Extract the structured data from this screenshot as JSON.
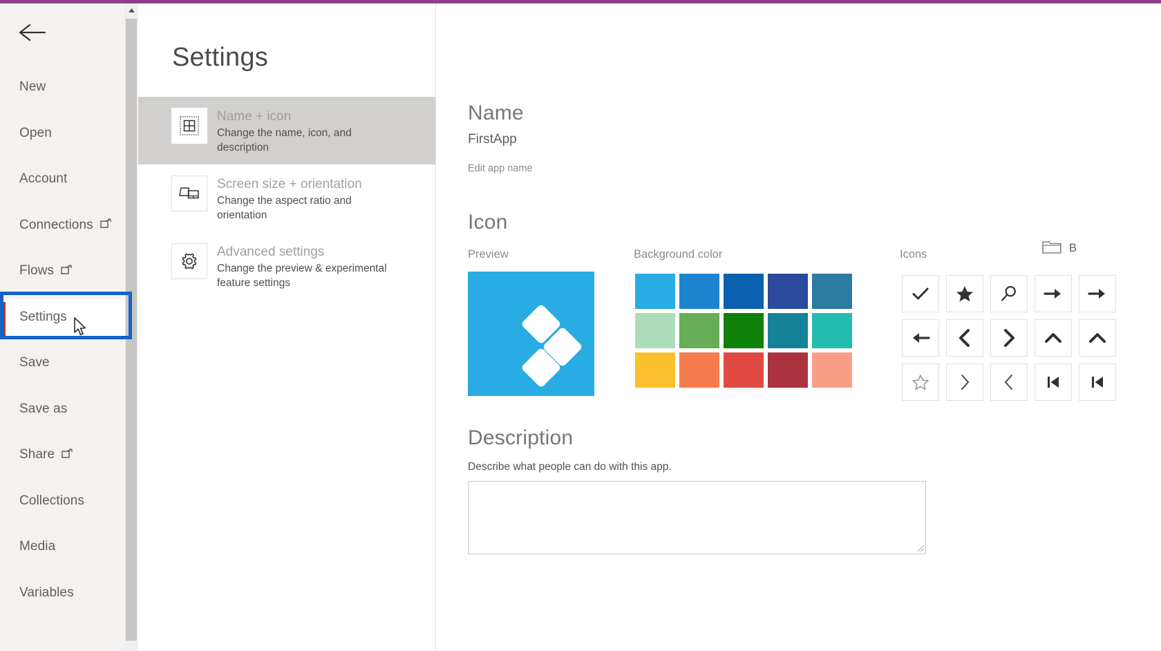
{
  "theme": {
    "accent_bar": "#8e3f8c",
    "focus_ring": "#1661c7",
    "selected_accent": "#a4373a",
    "preview_bg": "#29ace3"
  },
  "sidebar": {
    "back_icon": "back-arrow-icon",
    "items": [
      {
        "label": "New",
        "external": false
      },
      {
        "label": "Open",
        "external": false
      },
      {
        "label": "Account",
        "external": false
      },
      {
        "label": "Connections",
        "external": true
      },
      {
        "label": "Flows",
        "external": true
      },
      {
        "label": "Settings",
        "external": false,
        "selected": true
      },
      {
        "label": "Save",
        "external": false
      },
      {
        "label": "Save as",
        "external": false
      },
      {
        "label": "Share",
        "external": true
      },
      {
        "label": "Collections",
        "external": false
      },
      {
        "label": "Media",
        "external": false
      },
      {
        "label": "Variables",
        "external": false
      }
    ]
  },
  "mid_panel": {
    "title": "Settings",
    "cards": [
      {
        "title": "Name + icon",
        "subtitle": "Change the name, icon, and description",
        "icon": "app-tile-icon",
        "active": true
      },
      {
        "title": "Screen size + orientation",
        "subtitle": "Change the aspect ratio and orientation",
        "icon": "devices-icon",
        "active": false
      },
      {
        "title": "Advanced settings",
        "subtitle": "Change the preview & experimental feature settings",
        "icon": "gear-icon",
        "active": false
      }
    ]
  },
  "content": {
    "name_section": {
      "heading": "Name",
      "app_name": "FirstApp",
      "edit_link": "Edit app name"
    },
    "icon_section": {
      "heading": "Icon",
      "preview_label": "Preview",
      "background_color_label": "Background color",
      "icons_label": "Icons",
      "browse_label": "B",
      "browse_icon": "folder-icon",
      "background_colors": [
        [
          "#29ace3",
          "#1c84cf",
          "#0c60b0",
          "#2b4a9b",
          "#2c7ba0"
        ],
        [
          "#addcbb",
          "#66ae55",
          "#0f8008",
          "#16829a",
          "#22bcb0"
        ],
        [
          "#fcc02e",
          "#f77a4f",
          "#e04a43",
          "#ab333f",
          "#f99f85"
        ]
      ],
      "icons": [
        [
          "check-icon",
          "star-filled-icon",
          "search-icon",
          "arrow-right-icon",
          "arrow-right-2-icon"
        ],
        [
          "arrow-left-icon",
          "chevron-left-icon",
          "chevron-right-icon",
          "chevron-up-icon",
          "chevron-up-2-icon"
        ],
        [
          "star-outline-icon",
          "chevron-right-thin-icon",
          "chevron-left-thin-icon",
          "skip-back-icon",
          "skip-back-2-icon"
        ]
      ]
    },
    "description_section": {
      "heading": "Description",
      "subtitle": "Describe what people can do with this app.",
      "value": "",
      "placeholder": ""
    }
  }
}
